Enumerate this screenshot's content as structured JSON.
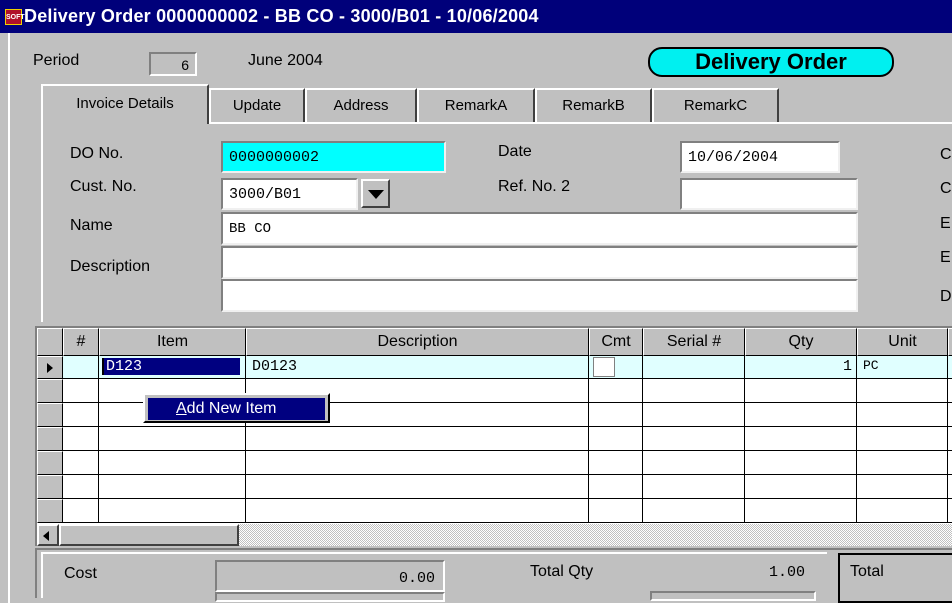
{
  "window": {
    "title": "Delivery Order 0000000002 - BB CO - 3000/B01 - 10/06/2004",
    "icon_text": "SOFT"
  },
  "header": {
    "period_label": "Period",
    "period_value": "6",
    "period_month": "June 2004",
    "doc_type": "Delivery Order"
  },
  "tabs": [
    {
      "label": "Invoice Details",
      "active": true
    },
    {
      "label": "Update"
    },
    {
      "label": "Address"
    },
    {
      "label": "RemarkA"
    },
    {
      "label": "RemarkB"
    },
    {
      "label": "RemarkC"
    }
  ],
  "form": {
    "do_no_label": "DO No.",
    "do_no": "0000000002",
    "cust_no_label": "Cust. No.",
    "cust_no": "3000/B01",
    "name_label": "Name",
    "name": "BB CO",
    "description_label": "Description",
    "description_1": "",
    "description_2": "",
    "date_label": "Date",
    "date": "10/06/2004",
    "ref_no2_label": "Ref. No. 2",
    "ref_no2": "",
    "right_cut_labels": [
      "C",
      "C",
      "E",
      "E",
      "D"
    ]
  },
  "grid": {
    "columns": [
      "#",
      "Item",
      "Description",
      "Cmt",
      "Serial #",
      "Qty",
      "Unit"
    ],
    "rows": [
      {
        "num": "",
        "item": "D123",
        "description": "D0123",
        "cmt": "",
        "serial": "",
        "qty": "1",
        "unit": "PC"
      }
    ]
  },
  "context_menu": {
    "item_underlined": "A",
    "item_rest": "dd New Item"
  },
  "footer": {
    "cost_label": "Cost",
    "cost_value": "0.00",
    "total_qty_label": "Total Qty",
    "total_qty_value": "1.00",
    "total_label": "Total"
  },
  "colors": {
    "title_bar": "#00007a",
    "highlight_field": "#00ffff",
    "grid_selected_row": "#e0ffff",
    "menu_highlight": "#000080"
  }
}
